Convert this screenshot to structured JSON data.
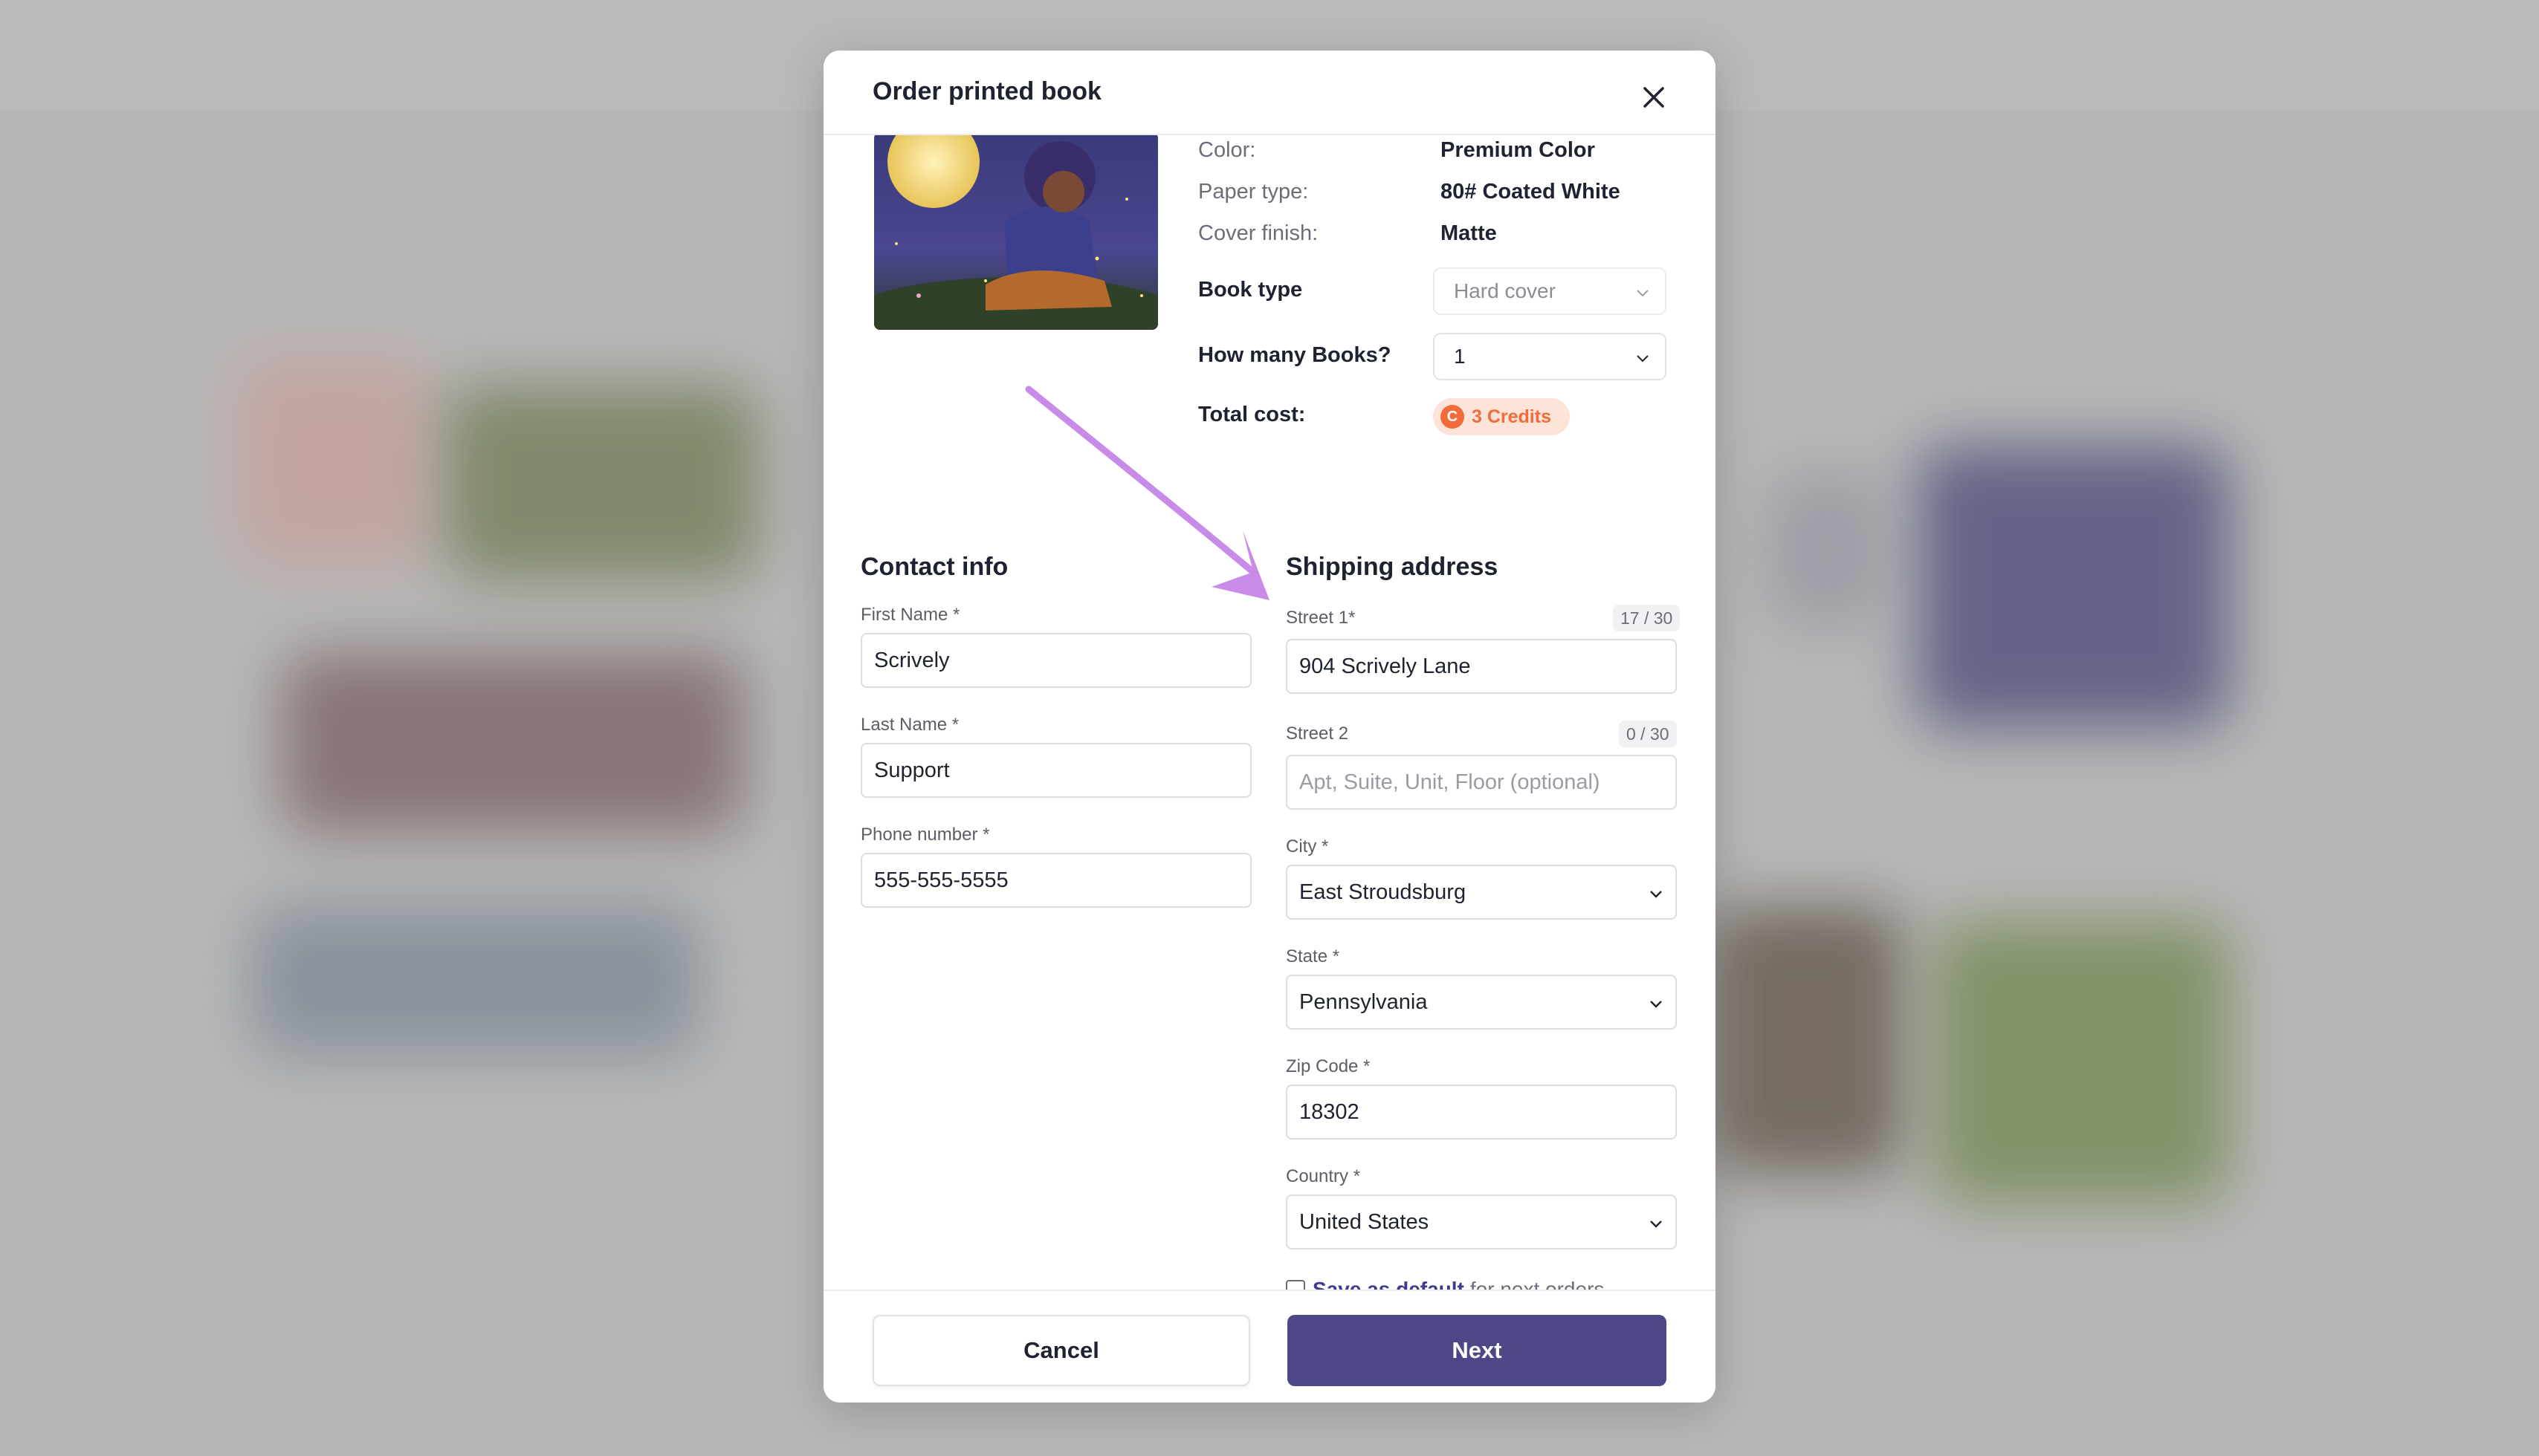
{
  "modal": {
    "title": "Order printed book"
  },
  "book_specs": [
    {
      "label": "Color:",
      "value": "Premium Color"
    },
    {
      "label": "Paper type:",
      "value": "80# Coated White"
    },
    {
      "label": "Cover finish:",
      "value": "Matte"
    }
  ],
  "book_type": {
    "label": "Book type",
    "value": "Hard cover"
  },
  "quantity": {
    "label": "How many Books?",
    "value": "1"
  },
  "total_cost": {
    "label": "Total cost:",
    "coin_symbol": "C",
    "value": "3 Credits"
  },
  "contact": {
    "title": "Contact info",
    "first_name": {
      "label": "First Name *",
      "value": "Scrively"
    },
    "last_name": {
      "label": "Last Name *",
      "value": "Support"
    },
    "phone": {
      "label": "Phone number *",
      "value": "555-555-5555"
    }
  },
  "shipping": {
    "title": "Shipping address",
    "street1": {
      "label": "Street 1*",
      "counter": "17 / 30",
      "value": "904 Scrively Lane"
    },
    "street2": {
      "label": "Street 2",
      "counter": "0 / 30",
      "value": "",
      "placeholder": "Apt, Suite, Unit, Floor (optional)"
    },
    "city": {
      "label": "City *",
      "value": "East Stroudsburg"
    },
    "state": {
      "label": "State *",
      "value": "Pennsylvania"
    },
    "zip": {
      "label": "Zip Code *",
      "value": "18302"
    },
    "country": {
      "label": "Country *",
      "value": "United States"
    },
    "save_default": {
      "link": "Save as default",
      "rest": "for next orders",
      "checked": false
    }
  },
  "footer": {
    "cancel_label": "Cancel",
    "next_label": "Next"
  },
  "colors": {
    "primary": "#4e4787",
    "credits_accent": "#f26b3a",
    "annotation_arrow": "#c98be8"
  }
}
